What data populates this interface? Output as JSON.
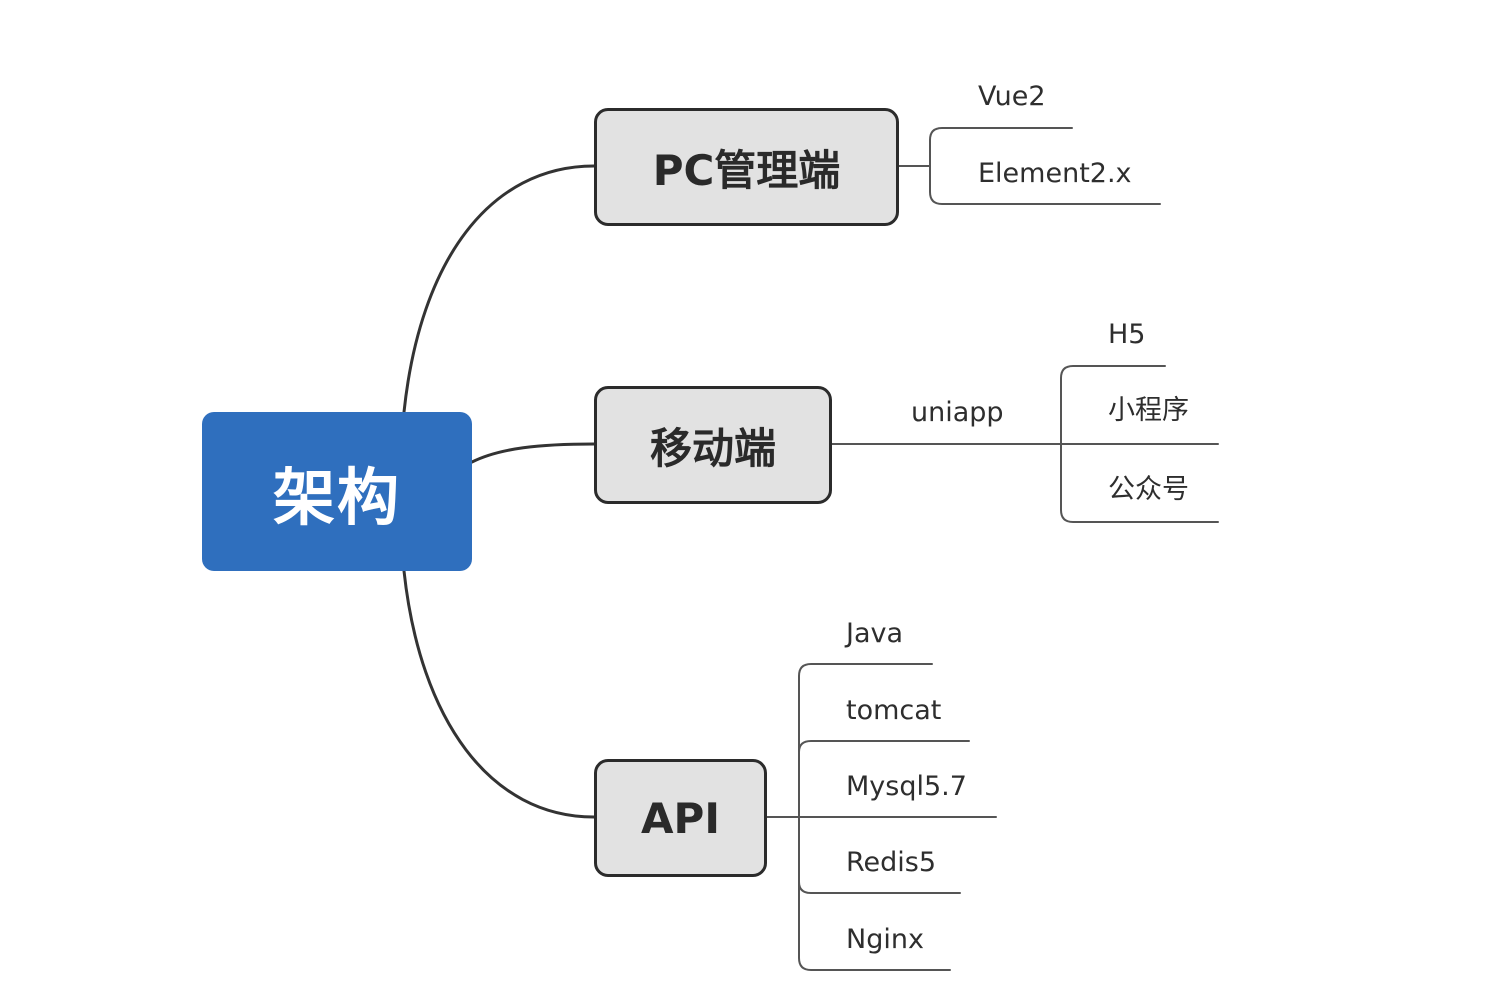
{
  "root": {
    "label": "架构",
    "color": "#2f6fbe"
  },
  "branches": [
    {
      "label": "PC管理端",
      "children": [
        "Vue2",
        "Element2.x"
      ]
    },
    {
      "label": "移动端",
      "connector": "uniapp",
      "children": [
        "H5",
        "小程序",
        "公众号"
      ]
    },
    {
      "label": "API",
      "children": [
        "Java",
        "tomcat",
        "Mysql5.7",
        "Redis5",
        "Nginx"
      ]
    }
  ]
}
